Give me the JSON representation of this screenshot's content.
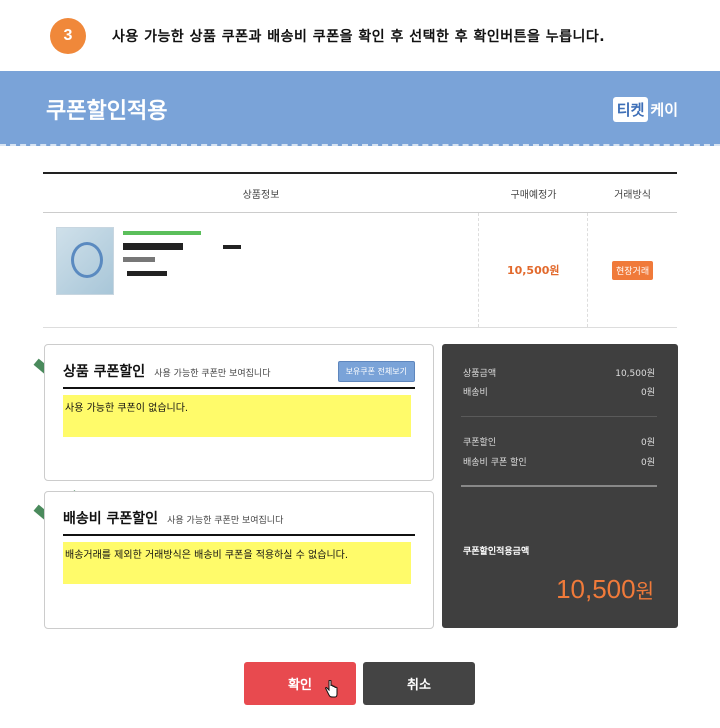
{
  "step": {
    "number": "3",
    "instruction": "사용 가능한 상품 쿠폰과 배송비 쿠폰을 확인 후 선택한 후 확인버튼을 누릅니다."
  },
  "banner": {
    "title": "쿠폰할인적용",
    "logo_box": "티켓",
    "logo_text": "케이"
  },
  "table": {
    "headers": [
      "상품정보",
      "구매예정가",
      "거래방식"
    ],
    "row": {
      "price": "10,500원",
      "method": "현장거래"
    }
  },
  "product_coupon": {
    "title": "상품 쿠폰할인",
    "subtitle": "사용 가능한 쿠폰만 보여집니다",
    "button": "보유쿠폰 전체보기",
    "message": "사용 가능한 쿠폰이 없습니다."
  },
  "shipping_coupon": {
    "title": "배송비 쿠폰할인",
    "subtitle": "사용 가능한 쿠폰만 보여집니다",
    "message": "배송거래를 제외한 거래방식은 배송비 쿠폰을 적용하실 수 없습니다."
  },
  "summary": {
    "rows": [
      {
        "label": "상품금액",
        "value": "10,500원"
      },
      {
        "label": "배송비",
        "value": "0원"
      },
      {
        "label": "쿠폰할인",
        "value": "0원"
      },
      {
        "label": "배송비 쿠폰 할인",
        "value": "0원"
      }
    ],
    "total_label": "쿠폰할인적용금액",
    "total_value": "10,500",
    "total_unit": "원"
  },
  "buttons": {
    "confirm": "확인",
    "cancel": "취소"
  },
  "colors": {
    "banner": "#7aa3d8",
    "accent": "#f07a3a",
    "confirm": "#e84a4f",
    "check": "#4a8a5c",
    "highlight": "#fffb6a"
  },
  "icons": [
    "checkmark-icon",
    "hand-cursor-icon"
  ]
}
